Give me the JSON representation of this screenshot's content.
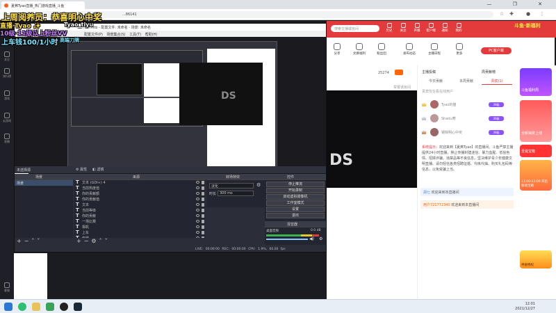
{
  "browser": {
    "tab_title": "夏弗Tyao直播_热门游戏直播_斗鱼",
    "address_fragment": "...86141",
    "window_controls": "— ❐ ✕"
  },
  "overlay": {
    "line1_prefix": "上周阅养员：",
    "line1_names": "恭喜明心中奖",
    "line2": "直播·Tyao ✨",
    "line2b": "Tyao_tiyu",
    "line3": "10级·11级以上粉丝VV",
    "line4": "上车钱100/1小时",
    "line4b": "高端刀牌"
  },
  "site_sidebar": [
    {
      "label": "关注"
    },
    {
      "label": "排行榜"
    },
    {
      "label": "游戏"
    },
    {
      "label": "云游戏"
    },
    {
      "label": "直播"
    },
    {
      "label": "客服"
    }
  ],
  "obs": {
    "title": "...(1).mtb - 配置文件: 未命名 - 场景: 未命名",
    "menu": "配置文件(P)  场景集合(S)  工具(T)  帮助(H)",
    "no_source": "未选择源",
    "props_label": "属性",
    "filter_label": "滤镜",
    "docks": {
      "scenes": "场景",
      "sources": "来源",
      "transitions": "转场特效",
      "controls": "控件"
    },
    "scene_item": "场景",
    "sources": [
      "文本 (GDI+) 4",
      "当前热度值",
      "你的贡献额",
      "你的贡献值",
      "文本",
      "当前等级",
      "你的贡献",
      "一场比赛",
      "相机",
      "上车",
      "传统"
    ],
    "transition": {
      "type": "淡化",
      "duration_label": "时长",
      "duration": "300 ms"
    },
    "controls": [
      "停止推流",
      "开始录制",
      "启动虚拟摄像机",
      "工作室模式",
      "设置",
      "退出"
    ],
    "mixer": {
      "label": "混音器",
      "track": "桌面音频",
      "level": "0.0 dB"
    },
    "status": {
      "live": "LIVE: 00:00:00",
      "rec": "REC: 00:00:00",
      "cpu": "CPU: 1.9%, 60.00 fps"
    }
  },
  "room": {
    "search_placeholder": "搜索主播或房间",
    "nav": [
      "历史",
      "关注",
      "开播",
      "客户端",
      "通知",
      "我的"
    ],
    "brand": "斗鱼·新福利",
    "anchor_actions": [
      "分享",
      "兑换福利",
      "粉丝团",
      "发布动态",
      "主播日程",
      "更多"
    ],
    "pc_button": "PC客户端",
    "follow_count": "25274",
    "report_label": "举报该房间",
    "player_text": "DS"
  },
  "panel": {
    "tabs_header": [
      "主播投稿",
      "周贡献榜"
    ],
    "tabs": [
      "今日贡献",
      "本周贡献",
      "贵宾(1)"
    ],
    "empty_hint": "贵宾仅在看在线用户",
    "ranks": [
      {
        "name": "Tyao的猫",
        "badge": "30级"
      },
      {
        "name": "Shadu寒",
        "badge": "30级"
      },
      {
        "name": "钢铁明心中奖",
        "badge": "30级"
      }
    ],
    "notice_title": "系统提示：",
    "notice_body": "欢迎来到【夏弗Tyao】的直播间。斗鱼严禁主播提供24小时直播，禁止传播封建迷信、暴力血腥、低俗色情、招嫖诈骗、违禁品等不良信息，坚决维护青少年健康文明直播。请勿轻信各类招聘征婚、代练代抽、购买礼包码等信息，以免受骗上当。",
    "messages": [
      {
        "name": "胡七",
        "text": "欢迎来到本直播间"
      },
      {
        "name": "用户721772340",
        "text": "欢迎来到本直播间"
      }
    ]
  },
  "ads": [
    "斗鱼福利周",
    "全新抽奖上线",
    "圣诞宝箱",
    "11:00-23:00 开启秘境宝箱",
    "神盾特权"
  ],
  "tray": {
    "time": "12:01",
    "date": "2021/12/27"
  }
}
